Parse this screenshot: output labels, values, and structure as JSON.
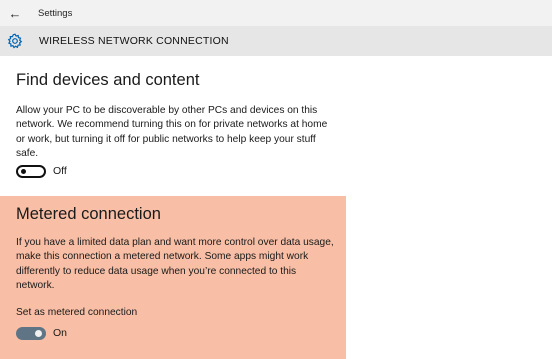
{
  "window": {
    "title": "Settings",
    "back_icon": "←"
  },
  "header": {
    "page_title": "WIRELESS NETWORK CONNECTION",
    "icon": "gear-icon",
    "accent": "#0063b1"
  },
  "find_devices": {
    "heading": "Find devices and content",
    "description": "Allow your PC to be discoverable by other PCs and devices on this network. We recommend turning this on for private networks at home or work, but turning it off for public networks to help keep your stuff safe.",
    "toggle_state": "Off"
  },
  "metered": {
    "heading": "Metered connection",
    "description": "If you have a limited data plan and want more control over data usage, make this connection a metered network. Some apps might work differently to reduce data usage when you’re connected to this network.",
    "setting_label": "Set as metered connection",
    "toggle_state": "On",
    "highlight_color": "#f8bfa6"
  }
}
